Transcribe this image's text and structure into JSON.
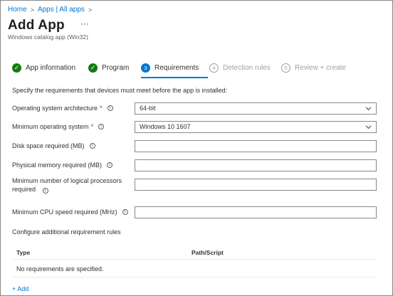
{
  "breadcrumb": {
    "home": "Home",
    "apps": "Apps | All apps"
  },
  "header": {
    "title": "Add App",
    "more": "···",
    "subtitle": "Windows catalog app (Win32)"
  },
  "steps": [
    {
      "label": "App information",
      "status": "done",
      "marker": "✓"
    },
    {
      "label": "Program",
      "status": "done",
      "marker": "✓"
    },
    {
      "label": "Requirements",
      "status": "active",
      "marker": "3"
    },
    {
      "label": "Detection rules",
      "status": "pending",
      "marker": "4"
    },
    {
      "label": "Review + create",
      "status": "pending",
      "marker": "5"
    }
  ],
  "instructions": "Specify the requirements that devices must meet before the app is installed:",
  "form": {
    "os_architecture": {
      "label": "Operating system architecture",
      "required": "*",
      "value": "64-bit"
    },
    "min_os": {
      "label": "Minimum operating system",
      "required": "*",
      "value": "Windows 10 1607"
    },
    "disk_space": {
      "label": "Disk space required (MB)",
      "value": ""
    },
    "physical_memory": {
      "label": "Physical memory required (MB)",
      "value": ""
    },
    "logical_processors": {
      "label": "Minimum number of logical processors required",
      "value": ""
    },
    "cpu_speed": {
      "label": "Minimum CPU speed required (MHz)",
      "value": ""
    }
  },
  "additional_rules": {
    "label": "Configure additional requirement rules",
    "columns": [
      "Type",
      "Path/Script"
    ],
    "empty_text": "No requirements are specified.",
    "add_label": "+ Add"
  },
  "icons": {
    "info": "info-icon",
    "chevron": "chevron-down-icon",
    "check": "check-icon"
  },
  "colors": {
    "accent": "#0078d4",
    "success": "#107c10",
    "required": "#a4262c",
    "disabled": "#a19f9d"
  }
}
